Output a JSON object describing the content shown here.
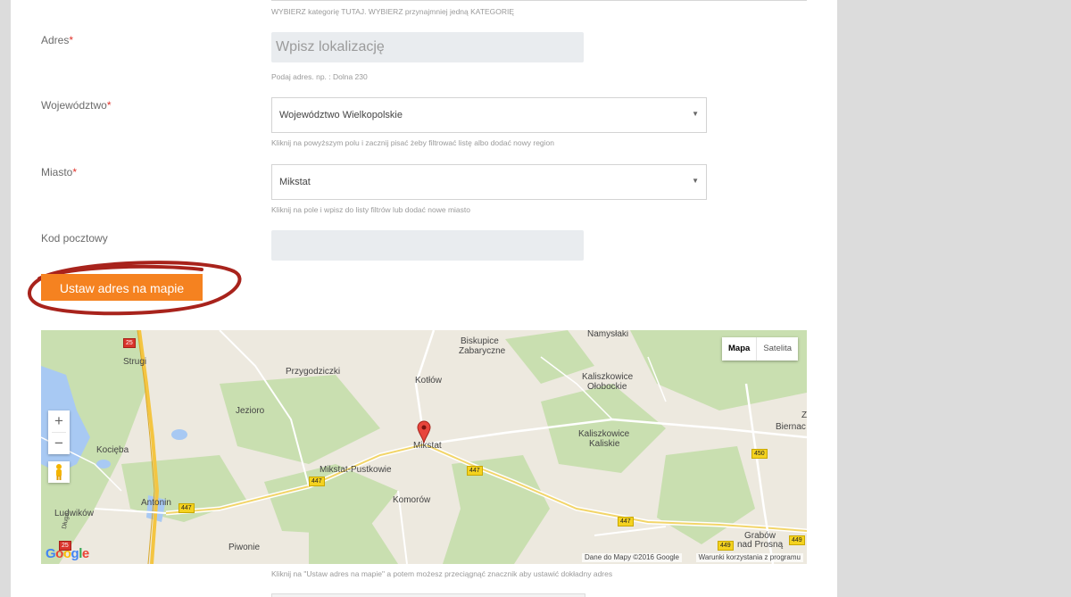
{
  "form": {
    "category_hint": "WYBIERZ kategorię TUTAJ. WYBIERZ przynajmniej jedną KATEGORIĘ",
    "address": {
      "label": "Adres",
      "required_mark": "*",
      "placeholder": "Wpisz lokalizację",
      "hint": "Podaj adres. np. : Dolna 230"
    },
    "region": {
      "label": "Województwo",
      "required_mark": "*",
      "value": "Województwo Wielkopolskie",
      "hint": "Kliknij na powyższym polu i zacznij pisać żeby filtrować listę albo dodać nowy region"
    },
    "city": {
      "label": "Miasto",
      "required_mark": "*",
      "value": "Mikstat",
      "hint": "Kliknij na pole i wpisz do listy filtrów lub dodać nowe miasto"
    },
    "postal": {
      "label": "Kod pocztowy",
      "value": ""
    },
    "set_on_map_button": "Ustaw adres na mapie",
    "map_hint": "Kliknij na \"Ustaw adres na mapie\" a potem możesz przeciągnąć znacznik aby ustawić dokładny adres"
  },
  "map": {
    "type_map": "Mapa",
    "type_satellite": "Satelita",
    "zoom_in": "+",
    "zoom_out": "−",
    "logo": "Google",
    "attribution": "Dane do Mapy ©2016 Google",
    "terms": "Warunki korzystania z programu",
    "places": {
      "namyslaki": "Namysłaki",
      "biskupice": "Biskupice",
      "zabaryczne": "Zabaryczne",
      "strugi": "Strugi",
      "przygodziczki": "Przygodziczki",
      "kotlow": "Kotłów",
      "kaliszkowice_olobockie_1": "Kaliszkowice",
      "kaliszkowice_olobockie_2": "Ołobockie",
      "jezioro": "Jezioro",
      "mikstat": "Mikstat",
      "kaliszkowice_kaliskie_1": "Kaliszkowice",
      "kaliszkowice_kaliskie_2": "Kaliskie",
      "kocieba": "Kocięba",
      "mikstat_pustkowie": "Mikstat-Pustkowie",
      "komorow": "Komorów",
      "antonin": "Antonin",
      "ludwikow": "Ludwików",
      "piwonie": "Piwonie",
      "grabow_1": "Grabów",
      "grabow_2": "nad Prosną",
      "biernacice": "Biernac",
      "z_edge": "Z",
      "dluga": "Długa"
    },
    "road_shields": {
      "r25_top": "25",
      "r25_bottom": "25",
      "r447_a": "447",
      "r447_b": "447",
      "r447_c": "447",
      "r447_d": "447",
      "r450": "450",
      "r449_a": "449",
      "r449_b": "449"
    }
  },
  "colors": {
    "accent": "#f58220",
    "required": "#e0322b",
    "annotation_circle": "#a8231c",
    "map_green": "#c9dfb0",
    "map_water": "#a8c9f3"
  }
}
